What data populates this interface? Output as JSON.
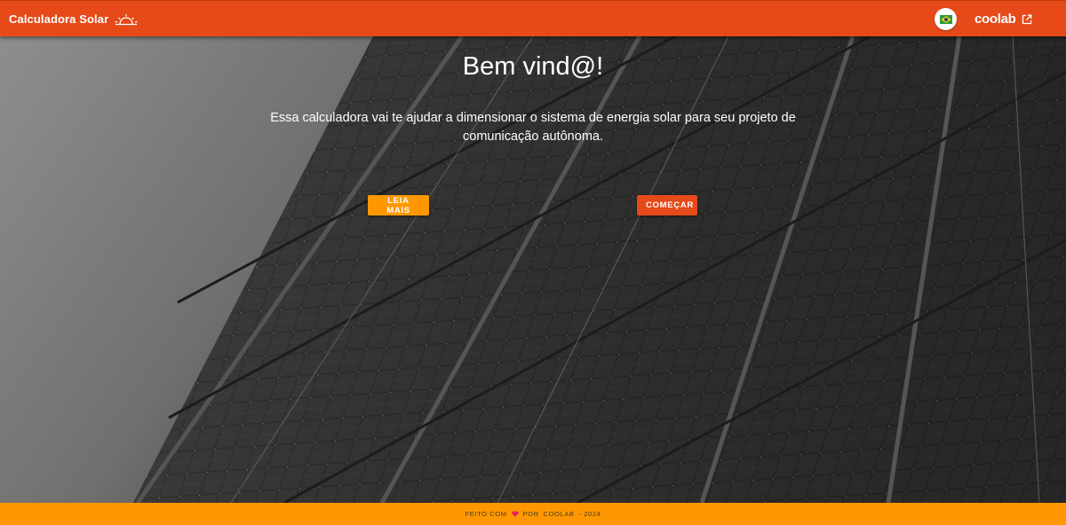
{
  "app": {
    "title": "Calculadora Solar",
    "sun_icon": "sunrise-icon",
    "language_icon": "brazil-flag-icon",
    "partner_logo": "COOLAB",
    "external_link_icon": "external-link-icon"
  },
  "hero": {
    "heading": "Bem vind@!",
    "description": "Essa calculadora vai te ajudar a dimensionar o sistema de energia solar para seu projeto de comunicação autônoma.",
    "background": "solar-panels-photo",
    "buttons": {
      "more_label": "LEIA MAIS",
      "start_label": "COMEÇAR"
    }
  },
  "footer": {
    "made_with": "FEITO COM",
    "heart_icon": "heart-icon",
    "by": "POR",
    "author": "COOLAB",
    "year": "- 2024"
  },
  "colors": {
    "primary": "#e64a19",
    "accent": "#ff9800",
    "heart": "#e91e63"
  }
}
